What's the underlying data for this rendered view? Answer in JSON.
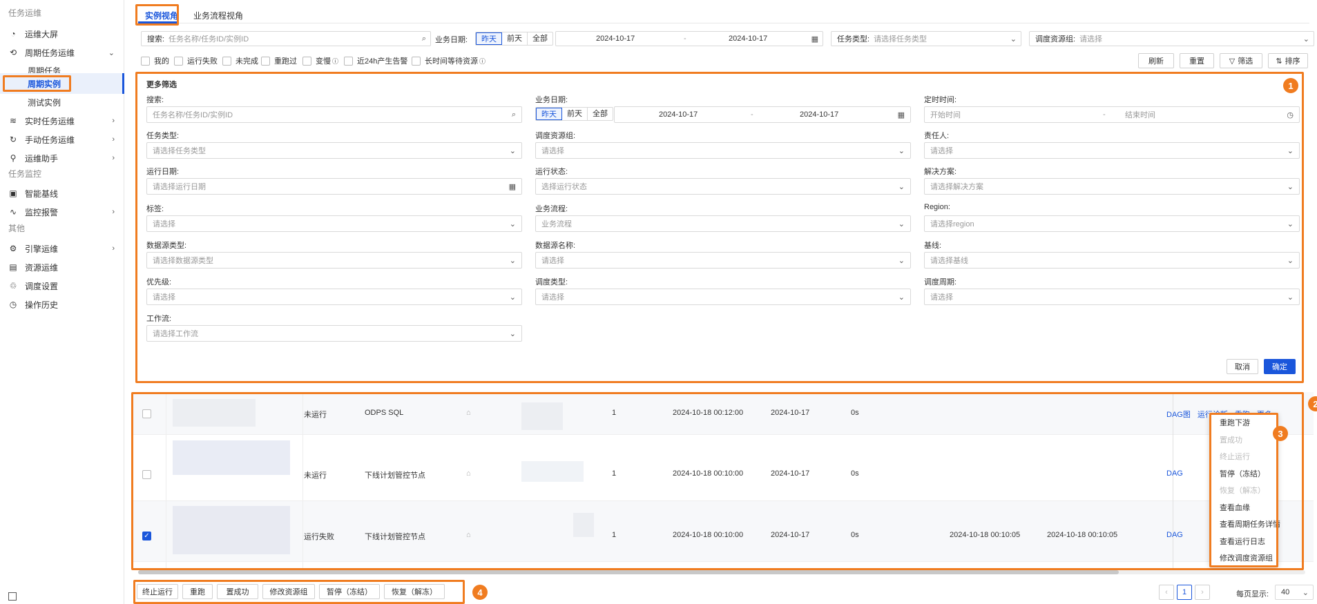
{
  "sidebar": {
    "sections": [
      "任务运维",
      "任务监控",
      "其他"
    ],
    "items": [
      {
        "label": "运维大屏",
        "icon": "pie-chart-icon",
        "arrow": false
      },
      {
        "label": "周期任务运维",
        "icon": "cycle-icon",
        "arrow": true
      },
      {
        "label": "周期任务",
        "sub": true
      },
      {
        "label": "周期实例",
        "sub": true,
        "active": true
      },
      {
        "label": "测试实例",
        "sub": true
      },
      {
        "label": "实时任务运维",
        "icon": "wave-icon",
        "arrow": true
      },
      {
        "label": "手动任务运维",
        "icon": "manual-icon",
        "arrow": true
      },
      {
        "label": "运维助手",
        "icon": "assistant-icon",
        "arrow": true
      },
      {
        "label": "智能基线",
        "icon": "baseline-icon",
        "arrow": false
      },
      {
        "label": "监控报警",
        "icon": "alarm-icon",
        "arrow": true
      },
      {
        "label": "引擎运维",
        "icon": "engine-icon",
        "arrow": true
      },
      {
        "label": "资源运维",
        "icon": "resource-icon",
        "arrow": false
      },
      {
        "label": "调度设置",
        "icon": "schedule-icon",
        "arrow": false
      },
      {
        "label": "操作历史",
        "icon": "history-icon",
        "arrow": false
      }
    ]
  },
  "tabs": [
    "实例视角",
    "业务流程视角"
  ],
  "search": {
    "label": "搜索:",
    "placeholder": "任务名称/任务ID/实例ID"
  },
  "biz_date": {
    "label": "业务日期:",
    "seg": [
      "昨天",
      "前天",
      "全部"
    ],
    "start": "2024-10-17",
    "end": "2024-10-17",
    "sep": "-"
  },
  "task_type": {
    "label": "任务类型:",
    "placeholder": "请选择任务类型"
  },
  "res_group": {
    "label": "调度资源组:",
    "placeholder": "请选择"
  },
  "quick_filters": [
    "我的",
    "运行失败",
    "未完成",
    "重跑过",
    "变慢",
    "近24h产生告警",
    "长时间等待资源"
  ],
  "toolbar": {
    "refresh": "刷新",
    "reset": "重置",
    "filter": "筛选",
    "sort": "排序"
  },
  "more_filter": {
    "title": "更多筛选",
    "fields": [
      {
        "label": "搜索:",
        "placeholder": "任务名称/任务ID/实例ID"
      },
      {
        "label": "业务日期:",
        "start": "2024-10-17",
        "end": "2024-10-17"
      },
      {
        "label": "定时时间:",
        "start": "开始时间",
        "end": "结束时间"
      },
      {
        "label": "任务类型:",
        "placeholder": "请选择任务类型"
      },
      {
        "label": "调度资源组:",
        "placeholder": "请选择"
      },
      {
        "label": "责任人:",
        "placeholder": "请选择"
      },
      {
        "label": "运行日期:",
        "placeholder": "请选择运行日期"
      },
      {
        "label": "运行状态:",
        "placeholder": "选择运行状态"
      },
      {
        "label": "解决方案:",
        "placeholder": "请选择解决方案"
      },
      {
        "label": "标签:",
        "placeholder": "请选择"
      },
      {
        "label": "业务流程:",
        "placeholder": "业务流程"
      },
      {
        "label": "Region:",
        "placeholder": "请选择region"
      },
      {
        "label": "数据源类型:",
        "placeholder": "请选择数据源类型"
      },
      {
        "label": "数据源名称:",
        "placeholder": "请选择"
      },
      {
        "label": "基线:",
        "placeholder": "请选择基线"
      },
      {
        "label": "优先级:",
        "placeholder": "请选择"
      },
      {
        "label": "调度类型:",
        "placeholder": "请选择"
      },
      {
        "label": "调度周期:",
        "placeholder": "请选择"
      },
      {
        "label": "工作流:",
        "placeholder": "请选择工作流"
      }
    ],
    "cancel": "取消",
    "confirm": "确定"
  },
  "table": {
    "rows": [
      {
        "status": "未运行",
        "type": "ODPS SQL",
        "priority": "1",
        "schedule": "2024-10-18 00:12:00",
        "biz_date": "2024-10-17",
        "duration": "0s",
        "start": "",
        "end": "",
        "checked": false
      },
      {
        "status": "未运行",
        "type": "下线计划管控节点",
        "priority": "1",
        "schedule": "2024-10-18 00:10:00",
        "biz_date": "2024-10-17",
        "duration": "0s",
        "start": "",
        "end": "",
        "checked": false
      },
      {
        "status": "运行失败",
        "type": "下线计划管控节点",
        "priority": "1",
        "schedule": "2024-10-18 00:10:00",
        "biz_date": "2024-10-17",
        "duration": "0s",
        "start": "2024-10-18 00:10:05",
        "end": "2024-10-18 00:10:05",
        "checked": true
      }
    ],
    "actions": {
      "dag": "DAG图",
      "diagnose": "运行诊断",
      "rerun": "重跑",
      "more": "更多",
      "dag_short": "DAG"
    }
  },
  "more_menu": [
    {
      "label": "重跑下游",
      "disabled": false
    },
    {
      "label": "置成功",
      "disabled": true
    },
    {
      "label": "终止运行",
      "disabled": true
    },
    {
      "label": "暂停（冻结）",
      "disabled": false
    },
    {
      "label": "恢复（解冻）",
      "disabled": true
    },
    {
      "label": "查看血缘",
      "disabled": false
    },
    {
      "label": "查看周期任务详情",
      "disabled": false
    },
    {
      "label": "查看运行日志",
      "disabled": false
    },
    {
      "label": "修改调度资源组",
      "disabled": false
    }
  ],
  "bulk_actions": [
    "终止运行",
    "重跑",
    "置成功",
    "修改资源组",
    "暂停（冻结）",
    "恢复（解冻）"
  ],
  "pagination": {
    "page": "1",
    "page_size_label": "每页显示:",
    "page_size": "40"
  },
  "callouts": [
    "1",
    "2",
    "3",
    "4"
  ],
  "colors": {
    "accent": "#1a56db",
    "highlight": "#f07c20"
  }
}
